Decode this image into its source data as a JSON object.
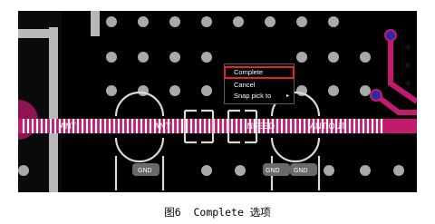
{
  "context_menu": {
    "items": [
      {
        "label": "Complete",
        "highlighted": true
      },
      {
        "label": "Cancel"
      },
      {
        "label": "Snap pick to",
        "submenu_arrow": "▸"
      }
    ]
  },
  "board": {
    "net_labels": {
      "ant_left": "ANT",
      "ant_mid": "ANT",
      "ant_out": "ANT-OUT",
      "infeed": "INFEED",
      "gnd_left": "GND",
      "gnd_mid": "GND",
      "gnd_right": "GND"
    },
    "colors": {
      "background": "#000000",
      "pad": "#bdbdbd",
      "trace": "#c21a6d",
      "via_highlight": "#2a2aa8",
      "menu_highlight": "#e3232a"
    }
  },
  "caption": "图6  Complete 选项"
}
